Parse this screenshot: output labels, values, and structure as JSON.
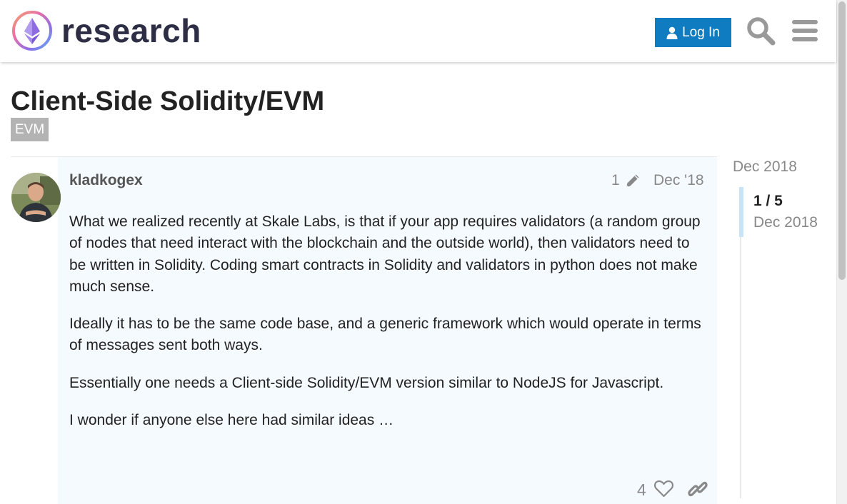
{
  "header": {
    "site_name": "research",
    "login_label": "Log In"
  },
  "topic": {
    "title": "Client-Side Solidity/EVM",
    "tag": "EVM"
  },
  "post": {
    "username": "kladkogex",
    "edit_count": "1",
    "date": "Dec '18",
    "paragraphs": [
      "What we realized recently at Skale Labs, is that if your app requires validators (a random group of nodes that need interact with the blockchain and the outside world), then validators need to be written in Solidity. Coding smart contracts in Solidity and validators in python does not make much sense.",
      "Ideally it has to be the same code base, and a generic framework which would operate in terms of messages sent both ways.",
      "Essentially one needs a Client-side Solidity/EVM version similar to NodeJS for Javascript.",
      "I wonder if anyone else here had similar ideas …"
    ],
    "like_count": "4"
  },
  "timeline": {
    "top_date": "Dec 2018",
    "position": "1 / 5",
    "current_date": "Dec 2018"
  },
  "colors": {
    "accent": "#0f7bc0",
    "post_background": "#f5fafe",
    "tag_background": "#b3b3b3"
  }
}
